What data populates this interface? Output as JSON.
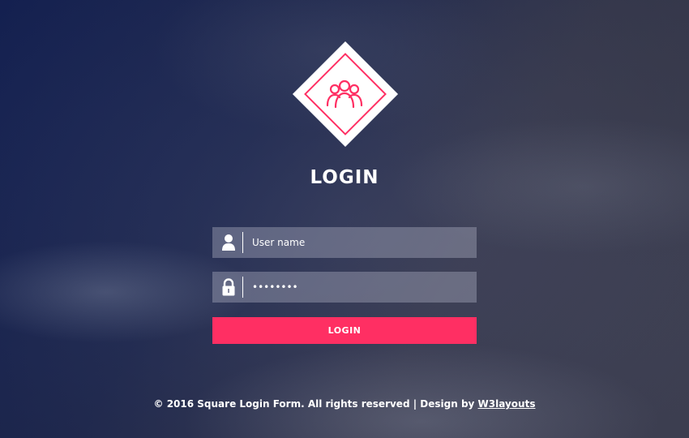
{
  "header": {
    "title": "LOGIN",
    "logo_icon": "users-group-icon"
  },
  "form": {
    "username": {
      "placeholder": "User name",
      "value": "",
      "icon": "user-icon"
    },
    "password": {
      "value": "••••••••",
      "icon": "lock-icon"
    },
    "submit_label": "LOGIN"
  },
  "footer": {
    "text": "© 2016 Square Login Form. All rights reserved | Design by ",
    "link_text": "W3layouts"
  },
  "colors": {
    "accent": "#ff2f63",
    "field_bg": "rgba(170,172,190,0.42)",
    "text": "#ffffff"
  }
}
